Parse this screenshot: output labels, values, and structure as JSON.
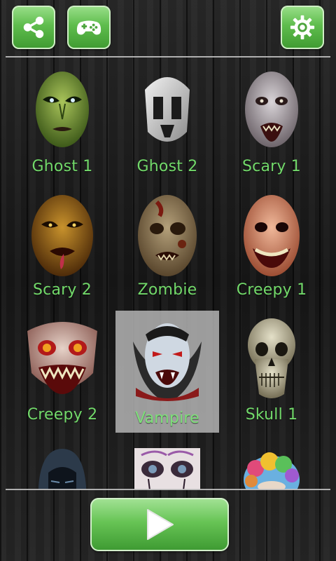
{
  "toolbar": {
    "share_icon": "share-icon",
    "games_icon": "gamepad-icon",
    "settings_icon": "gear-icon",
    "accent_color": "#5fbd4d"
  },
  "masks": [
    {
      "label": "Ghost 1"
    },
    {
      "label": "Ghost 2"
    },
    {
      "label": "Scary 1"
    },
    {
      "label": "Scary 2"
    },
    {
      "label": "Zombie"
    },
    {
      "label": "Creepy 1"
    },
    {
      "label": "Creepy 2"
    },
    {
      "label": "Vampire",
      "selected": true
    },
    {
      "label": "Skull 1"
    },
    {
      "label": ""
    },
    {
      "label": ""
    },
    {
      "label": ""
    }
  ],
  "play_button": {
    "icon": "play-icon"
  }
}
